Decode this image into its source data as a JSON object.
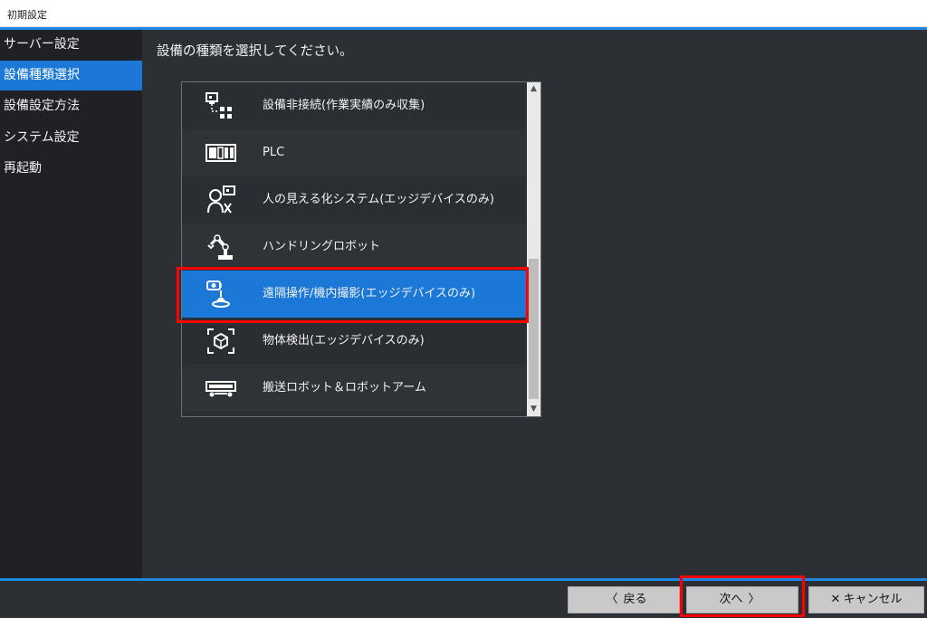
{
  "window": {
    "title": "初期設定"
  },
  "sidebar": {
    "items": [
      {
        "label": "サーバー設定"
      },
      {
        "label": "設備種類選択"
      },
      {
        "label": "設備設定方法"
      },
      {
        "label": "システム設定"
      },
      {
        "label": "再起動"
      }
    ],
    "active_index": 1
  },
  "main": {
    "heading": "設備の種類を選択してください。",
    "options": [
      {
        "label": "設備非接続(作業実績のみ収集)",
        "icon": "network-device-icon"
      },
      {
        "label": "PLC",
        "icon": "plc-icon"
      },
      {
        "label": "人の見える化システム(エッジデバイスのみ)",
        "icon": "worker-monitor-icon"
      },
      {
        "label": "ハンドリングロボット",
        "icon": "robot-arm-icon"
      },
      {
        "label": "遠隔操作/機内撮影(エッジデバイスのみ)",
        "icon": "remote-camera-icon"
      },
      {
        "label": "物体検出(エッジデバイスのみ)",
        "icon": "object-detect-icon"
      },
      {
        "label": "搬送ロボット＆ロボットアーム",
        "icon": "transport-robot-icon"
      }
    ],
    "selected_index": 4
  },
  "footer": {
    "back_label": "戻る",
    "back_chevron": "〈",
    "next_label": "次へ",
    "next_chevron": "〉",
    "cancel_label": "キャンセル",
    "cancel_symbol": "✕"
  },
  "colors": {
    "accent": "#1b78d6",
    "highlight": "#ff0000",
    "background": "#2c2f34"
  }
}
